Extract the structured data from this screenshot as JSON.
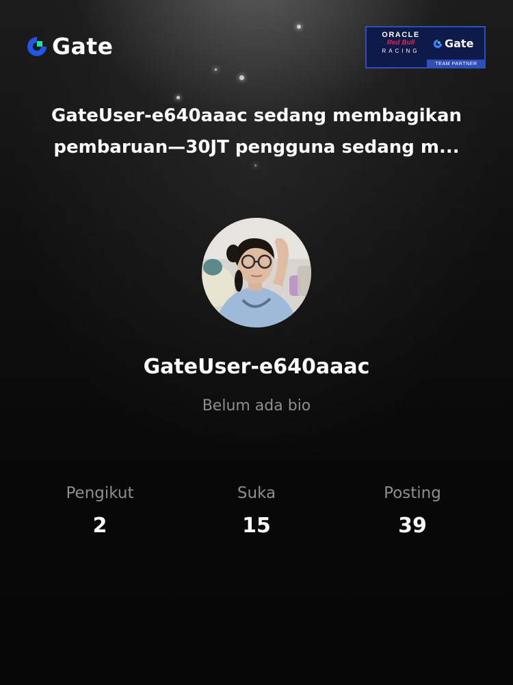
{
  "brand": {
    "logo_text": "Gate",
    "logo_icon": "gate-logo-icon",
    "accent_blue": "#2354e6",
    "accent_green": "#17e6a1"
  },
  "partner_badge": {
    "line1": "ORACLE",
    "line2": "Red Bull",
    "line3": "RACING",
    "brand": "Gate",
    "strip": "TEAM PARTNER",
    "background": "#0d1a4a",
    "border": "#2e4fb8"
  },
  "headline": {
    "line1": "GateUser-e640aaac sedang membagikan",
    "line2": "pembaruan—30JT pengguna sedang m..."
  },
  "profile": {
    "avatar_icon": "user-avatar-photo",
    "username": "GateUser-e640aaac",
    "bio": "Belum ada bio"
  },
  "stats": [
    {
      "label": "Pengikut",
      "value": "2"
    },
    {
      "label": "Suka",
      "value": "15"
    },
    {
      "label": "Posting",
      "value": "39"
    }
  ]
}
